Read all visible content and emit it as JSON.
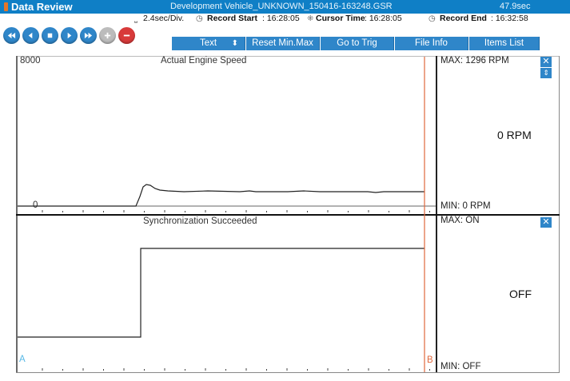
{
  "titlebar": {
    "app_title": "Data Review",
    "file_name": "Development Vehicle_UNKNOWN_150416-163248.GSR",
    "duration": "47.9sec"
  },
  "infobar": {
    "div": "2.4sec/Div.",
    "record_start_label": "Record Start",
    "record_start_value": ": 16:28:05",
    "cursor_time_label": "Cursor Time",
    "cursor_time_value": ": 16:28:05",
    "record_end_label": "Record End",
    "record_end_value": ": 16:32:58"
  },
  "toolbar": {
    "text_label": "Text",
    "reset_label": "Reset Min.Max",
    "trig_label": "Go to Trig",
    "fileinfo_label": "File Info",
    "items_label": "Items List"
  },
  "graphs": [
    {
      "title": "Actual Engine Speed",
      "ymax_label": "8000",
      "ymin_label": "0",
      "max_text": "MAX:  1296 RPM",
      "current_value": "0 RPM",
      "min_text": "MIN:    0 RPM"
    },
    {
      "title": "Synchronization Succeeded",
      "max_text": "MAX: ON",
      "current_value": "OFF",
      "min_text": "MIN: OFF",
      "cursor_a": "A",
      "cursor_b": "B"
    }
  ],
  "colors": {
    "accent": "#2f86c9",
    "title_bar": "#0f7fc6",
    "cursor_b": "#e0683c",
    "cursor_a": "#57b9e6"
  }
}
